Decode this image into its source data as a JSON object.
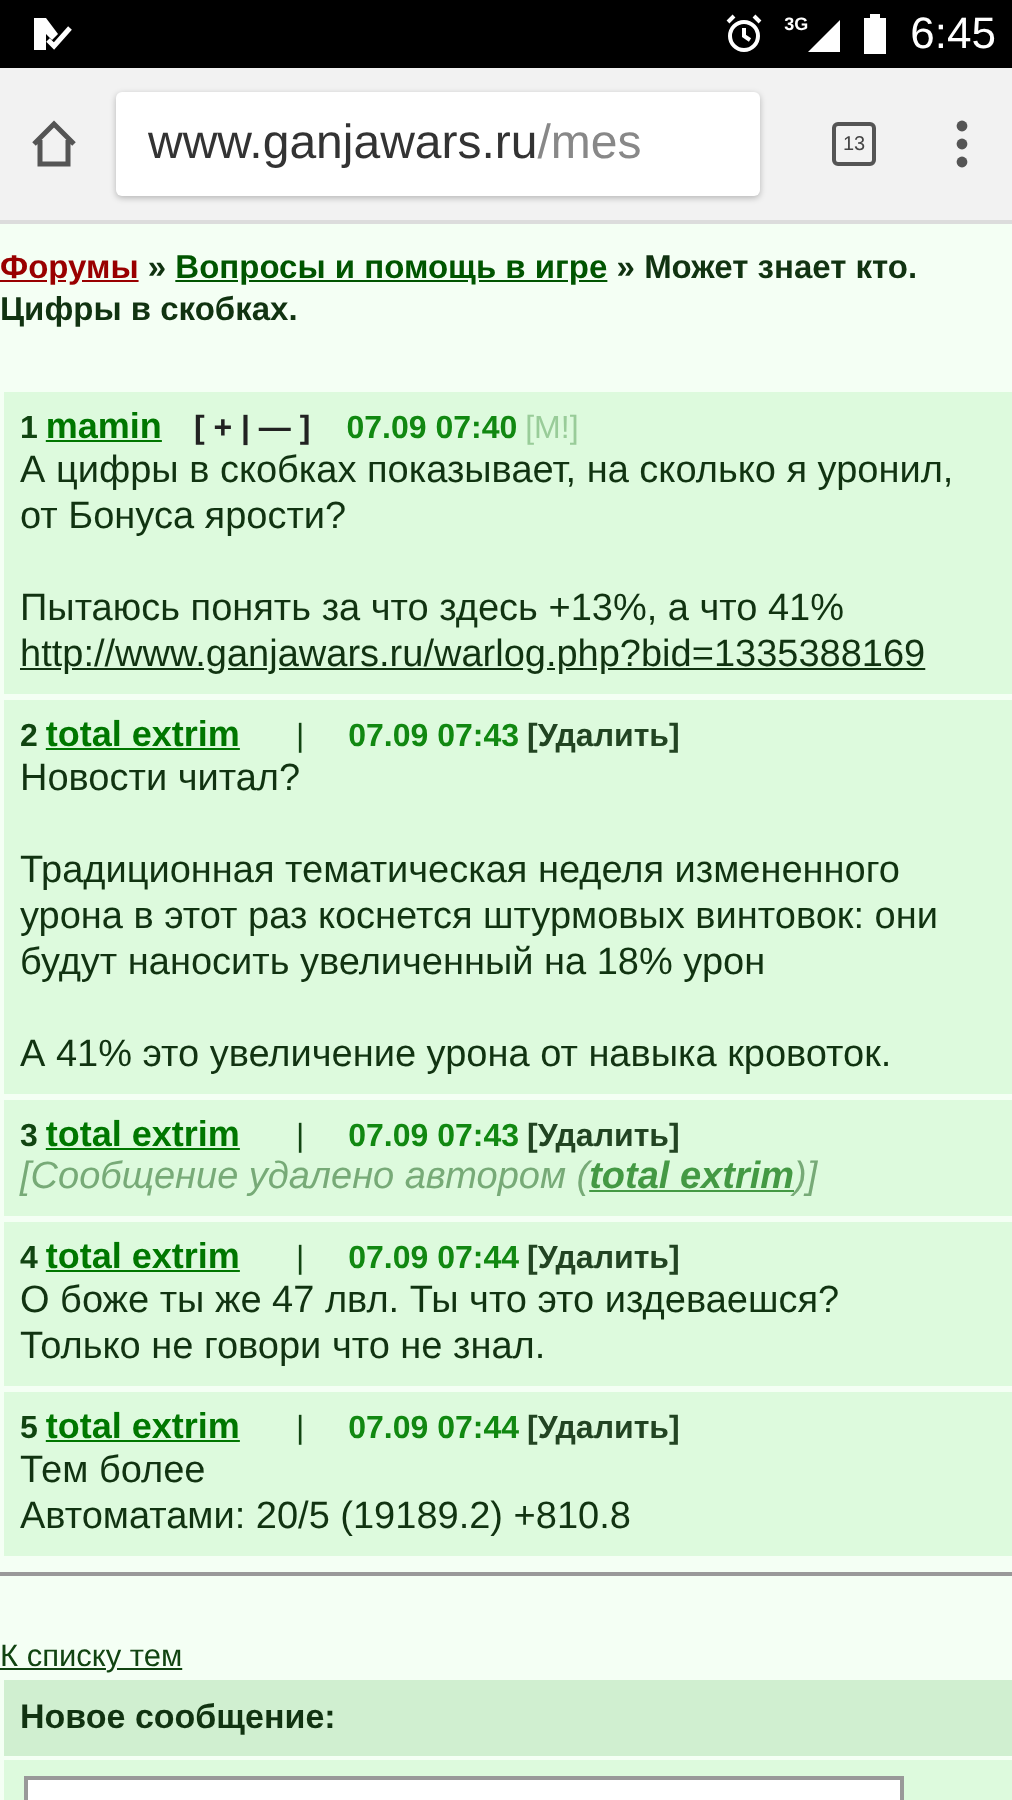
{
  "status_bar": {
    "network": "3G",
    "time": "6:45"
  },
  "browser": {
    "url_host": "www.ganjawars.ru",
    "url_path": "/mes",
    "tab_count": "13"
  },
  "breadcrumb": {
    "forums": "Форумы",
    "section": "Вопросы и помощь в игре",
    "separator": "»",
    "topic": "Может знает кто. Цифры в скобках."
  },
  "posts": [
    {
      "number": "1",
      "author": "mamin",
      "middle": {
        "kind": "rating",
        "text": "[ + | — ]"
      },
      "date": "07.09 07:40",
      "action": {
        "text": "[M!]",
        "disabled": true
      },
      "paragraphs": [
        {
          "lines": [
            {
              "kind": "text",
              "text": "А цифры в скобках показывает, на сколько я уронил, от Бонуса ярости?"
            }
          ]
        },
        {
          "lines": [
            {
              "kind": "text",
              "text": "Пытаюсь понять за что здесь +13%, а что 41%"
            },
            {
              "kind": "link",
              "text": "http://www.ganjawars.ru/warlog.php?bid=1335388169"
            }
          ]
        }
      ]
    },
    {
      "number": "2",
      "author": "total extrim",
      "middle": {
        "kind": "separator",
        "text": "|"
      },
      "date": "07.09 07:43",
      "action": {
        "text": "[Удалить]",
        "disabled": false
      },
      "paragraphs": [
        {
          "lines": [
            {
              "kind": "text",
              "text": "Новости читал?"
            }
          ]
        },
        {
          "lines": [
            {
              "kind": "text",
              "text": "Традиционная тематическая неделя измененного урона в этот раз коснется штурмовых винтовок: они будут наносить увеличенный на 18% урон"
            }
          ]
        },
        {
          "lines": [
            {
              "kind": "text",
              "text": "А 41% это увеличение урона от навыка кровоток."
            }
          ]
        }
      ]
    },
    {
      "number": "3",
      "author": "total extrim",
      "middle": {
        "kind": "separator",
        "text": "|"
      },
      "date": "07.09 07:43",
      "action": {
        "text": "[Удалить]",
        "disabled": false
      },
      "deleted_note": {
        "before": "[Сообщение удалено автором (",
        "author": "total extrim",
        "after": ")]"
      }
    },
    {
      "number": "4",
      "author": "total extrim",
      "middle": {
        "kind": "separator",
        "text": "|"
      },
      "date": "07.09 07:44",
      "action": {
        "text": "[Удалить]",
        "disabled": false
      },
      "paragraphs": [
        {
          "lines": [
            {
              "kind": "text",
              "text": "О боже ты же 47 лвл. Ты что это издеваешся?"
            },
            {
              "kind": "text",
              "text": "Только не говори что не знал."
            }
          ]
        }
      ]
    },
    {
      "number": "5",
      "author": "total extrim",
      "middle": {
        "kind": "separator",
        "text": "|"
      },
      "date": "07.09 07:44",
      "action": {
        "text": "[Удалить]",
        "disabled": false
      },
      "paragraphs": [
        {
          "lines": [
            {
              "kind": "text",
              "text": "Тем более"
            },
            {
              "kind": "text",
              "text": "Автоматами: 20/5 (19189.2) +810.8"
            }
          ]
        }
      ]
    }
  ],
  "back_link": "К списку тем",
  "new_message": {
    "title": "Новое сообщение:"
  }
}
